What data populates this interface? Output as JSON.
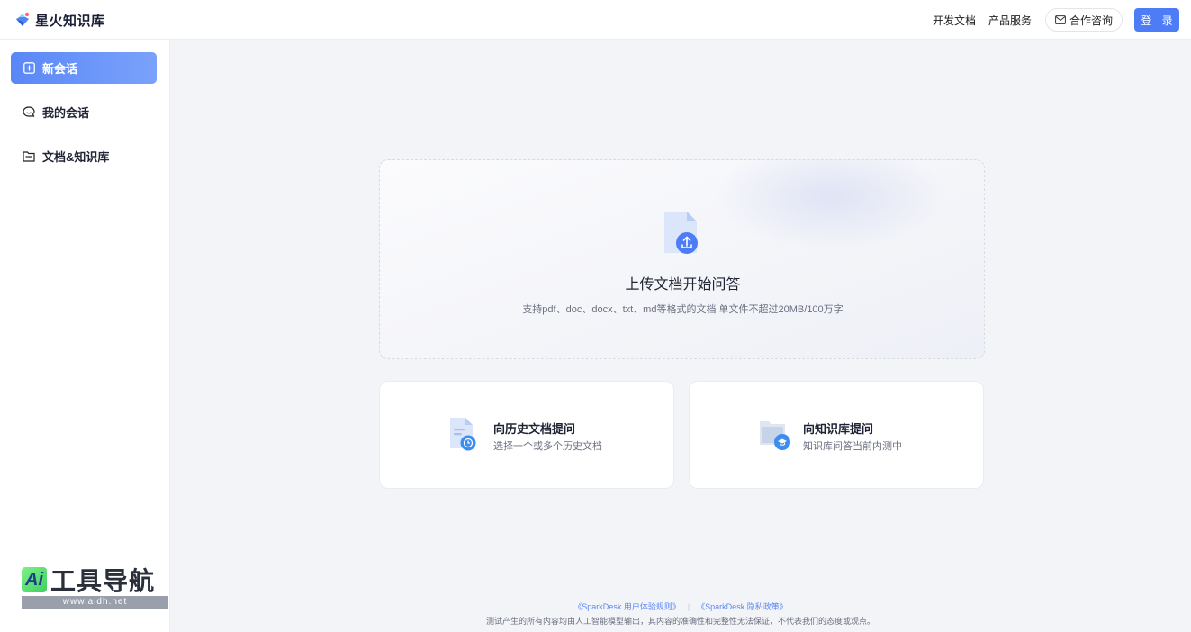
{
  "app": {
    "name": "星火知识库"
  },
  "header": {
    "nav": [
      "开发文档",
      "产品服务"
    ],
    "contact_label": "合作咨询",
    "login_label": "登 录"
  },
  "sidebar": {
    "items": [
      {
        "label": "新会话",
        "icon": "new-chat-icon"
      },
      {
        "label": "我的会话",
        "icon": "chat-bubble-icon"
      },
      {
        "label": "文档&知识库",
        "icon": "folder-icon"
      }
    ]
  },
  "upload": {
    "title": "上传文档开始问答",
    "subtitle": "支持pdf、doc、docx、txt、md等格式的文档 单文件不超过20MB/100万字"
  },
  "options": [
    {
      "title": "向历史文档提问",
      "subtitle": "选择一个或多个历史文档"
    },
    {
      "title": "向知识库提问",
      "subtitle": "知识库问答当前内测中"
    }
  ],
  "footer": {
    "links": [
      "《SparkDesk 用户体验规则》",
      "《SparkDesk 隐私政策》"
    ],
    "separator": "|",
    "note": "测试产生的所有内容均由人工智能模型输出，其内容的准确性和完整性无法保证，不代表我们的态度或观点。"
  },
  "watermark": {
    "badge": "Ai",
    "text": "工具导航",
    "url": "www.aidh.net"
  },
  "colors": {
    "accent": "#4e7cf6",
    "background": "#f3f4f7"
  }
}
